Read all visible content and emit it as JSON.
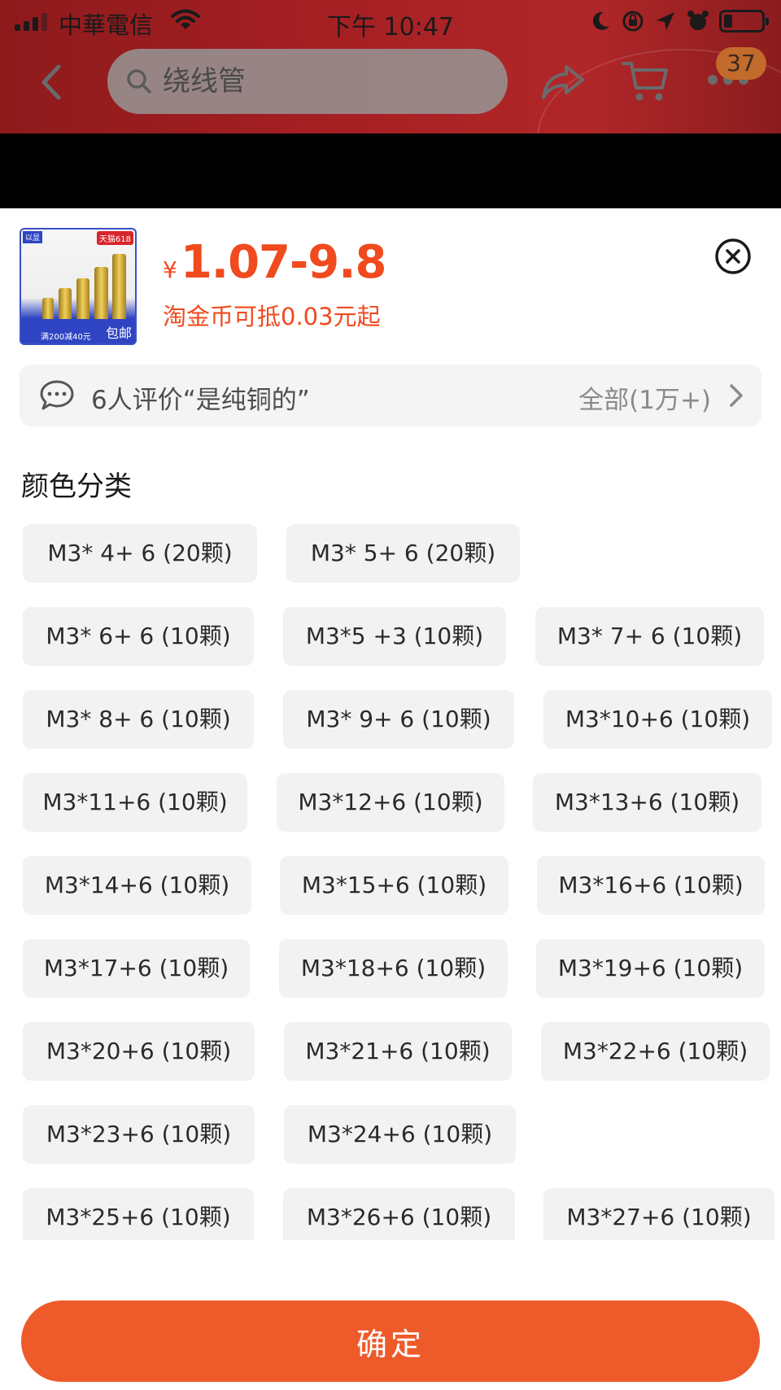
{
  "status_bar": {
    "carrier": "中華電信",
    "time": "下午 10:47"
  },
  "nav": {
    "search_placeholder": "绕线管",
    "cart_badge": "37"
  },
  "product": {
    "currency": "¥",
    "price_range": "1.07-9.8",
    "coin_text": "淘金币可抵0.03元起",
    "thumbnail": {
      "tag_top": "天猫618",
      "tag_left": "以显",
      "promo": "满200减40元",
      "shipping": "包邮"
    }
  },
  "review": {
    "text": "6人评价“是纯铜的”",
    "all_label": "全部(1万+)"
  },
  "section_title": "颜色分类",
  "options": [
    [
      "M3* 4+ 6 (20颗)",
      "M3* 5+ 6 (20颗)"
    ],
    [
      "M3* 6+ 6 (10颗)",
      "M3*5 +3 (10颗)",
      "M3* 7+ 6 (10颗)"
    ],
    [
      "M3* 8+ 6 (10颗)",
      "M3* 9+ 6 (10颗)",
      "M3*10+6 (10颗)"
    ],
    [
      "M3*11+6 (10颗)",
      "M3*12+6 (10颗)",
      "M3*13+6 (10颗)"
    ],
    [
      "M3*14+6 (10颗)",
      "M3*15+6 (10颗)",
      "M3*16+6 (10颗)"
    ],
    [
      "M3*17+6 (10颗)",
      "M3*18+6 (10颗)",
      "M3*19+6 (10颗)"
    ],
    [
      "M3*20+6 (10颗)",
      "M3*21+6 (10颗)",
      "M3*22+6 (10颗)"
    ],
    [
      "M3*23+6 (10颗)",
      "M3*24+6 (10颗)"
    ],
    [
      "M3*25+6 (10颗)",
      "M3*26+6 (10颗)",
      "M3*27+6 (10颗)"
    ]
  ],
  "confirm_label": "确定",
  "colors": {
    "accent": "#f04a1e",
    "confirm": "#ee5a2a",
    "nav_bg": "#a41f22"
  }
}
